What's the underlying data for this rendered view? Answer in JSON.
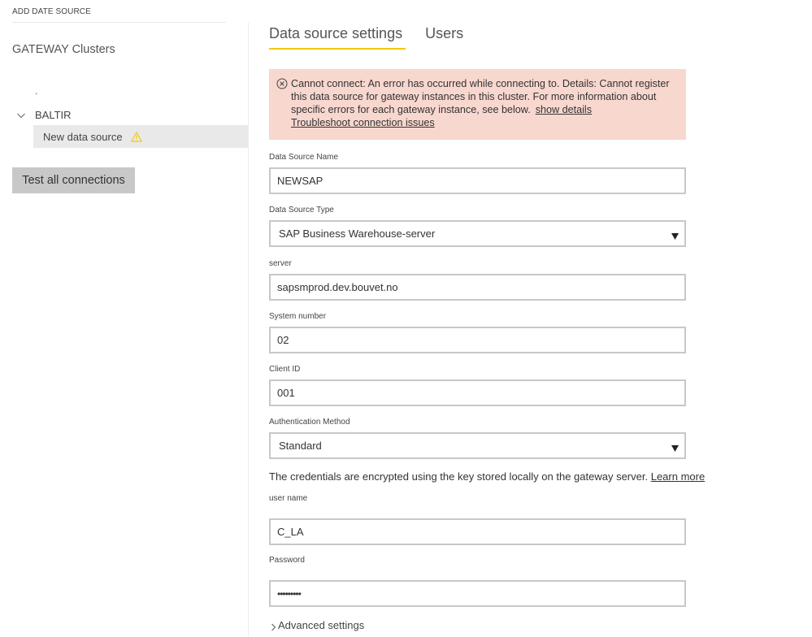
{
  "breadcrumb": "ADD DATE SOURCE",
  "sidebar": {
    "title": "GATEWAY Clusters",
    "unnamed_cluster": ".",
    "cluster": {
      "name": "BALTIR",
      "expanded": true,
      "icon": "chevron-down-icon",
      "items": [
        {
          "label": "New data source",
          "selected": true,
          "status_icon": "warning-icon",
          "status_color": "#f2c811"
        }
      ]
    },
    "test_button_label": "Test all connections"
  },
  "tabs": [
    {
      "label": "Data source settings",
      "active": true
    },
    {
      "label": "Users",
      "active": false
    }
  ],
  "accent_color": "#f2c811",
  "error": {
    "icon": "error-circle-x-icon",
    "background": "#f8d7cf",
    "message": "Cannot connect: An error has occurred while connecting to. Details: Cannot register this data source for gateway instances in this cluster. For more information about specific errors for each gateway instance, see below.",
    "show_details_link": "show details",
    "troubleshoot_link": "Troubleshoot connection issues"
  },
  "form": {
    "data_source_name": {
      "label": "Data Source Name",
      "value": "NEWSAP"
    },
    "data_source_type": {
      "label": "Data Source Type",
      "value": "SAP Business Warehouse-server"
    },
    "server": {
      "label": "server",
      "value": "sapsmprod.dev.bouvet.no"
    },
    "system_number": {
      "label": "System number",
      "value": "02"
    },
    "client_id": {
      "label": "Client ID",
      "value": "001"
    },
    "authentication_method": {
      "label": "Authentication Method",
      "value": "Standard"
    },
    "credentials_note": "The credentials are encrypted using the key stored locally on the gateway server.",
    "learn_more_link": "Learn more",
    "user_name": {
      "label": "user name",
      "value": "C_LA"
    },
    "password": {
      "label": "Password",
      "value": "•••••••••"
    },
    "advanced_settings_label": "Advanced settings"
  }
}
